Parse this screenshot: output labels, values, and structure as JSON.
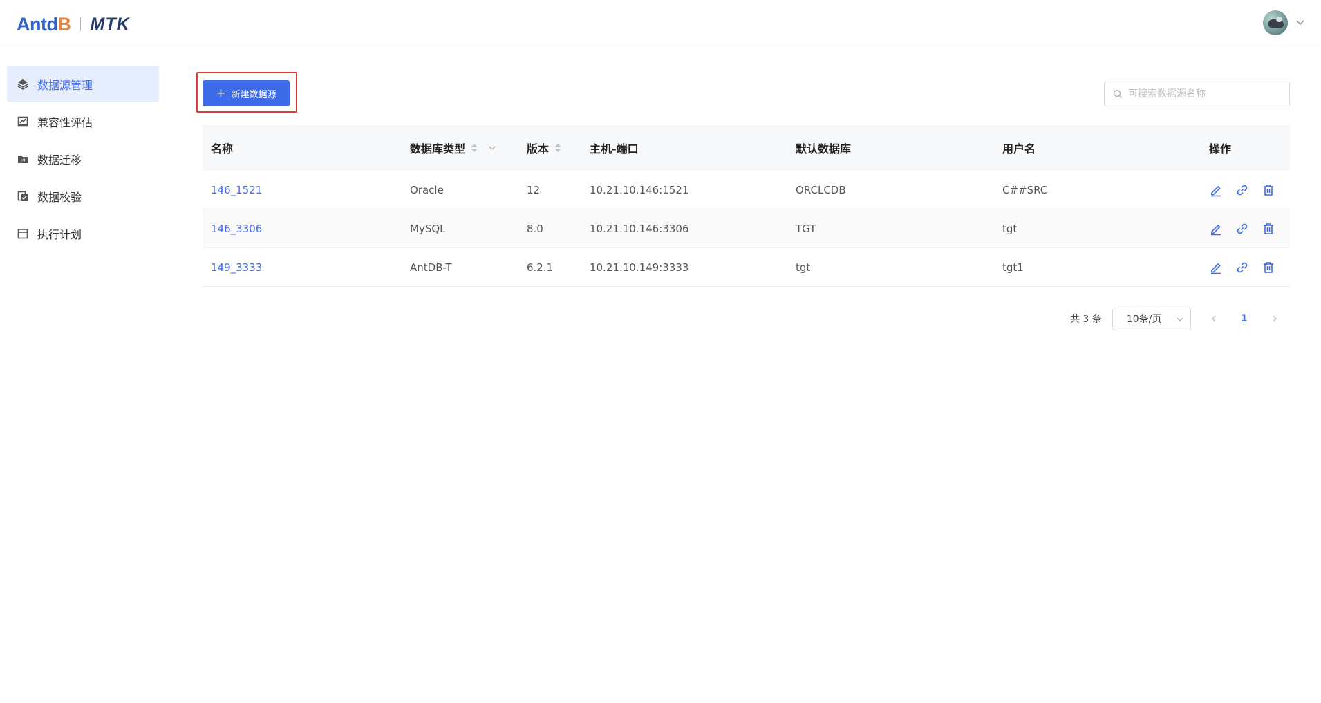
{
  "header": {
    "logo_part1": "Antd",
    "logo_part2": "B",
    "app_name": "MTK"
  },
  "sidebar": {
    "items": [
      {
        "label": "数据源管理",
        "icon": "layers-icon",
        "active": true
      },
      {
        "label": "兼容性评估",
        "icon": "chart-board-icon",
        "active": false
      },
      {
        "label": "数据迁移",
        "icon": "folder-arrow-icon",
        "active": false
      },
      {
        "label": "数据校验",
        "icon": "document-check-icon",
        "active": false
      },
      {
        "label": "执行计划",
        "icon": "calendar-icon",
        "active": false
      }
    ]
  },
  "toolbar": {
    "new_button_label": "新建数据源",
    "search_placeholder": "可搜索数据源名称"
  },
  "table": {
    "headers": {
      "name": "名称",
      "type": "数据库类型",
      "version": "版本",
      "host": "主机-端口",
      "default_db": "默认数据库",
      "user": "用户名",
      "ops": "操作"
    },
    "rows": [
      {
        "name": "146_1521",
        "type": "Oracle",
        "version": "12",
        "host": "10.21.10.146:1521",
        "default_db": "ORCLCDB",
        "user": "C##SRC"
      },
      {
        "name": "146_3306",
        "type": "MySQL",
        "version": "8.0",
        "host": "10.21.10.146:3306",
        "default_db": "TGT",
        "user": "tgt"
      },
      {
        "name": "149_3333",
        "type": "AntDB-T",
        "version": "6.2.1",
        "host": "10.21.10.149:3333",
        "default_db": "tgt",
        "user": "tgt1"
      }
    ]
  },
  "pagination": {
    "total": "共 3 条",
    "page_size": "10条/页",
    "current_page": "1"
  },
  "colors": {
    "primary": "#3e6be8",
    "highlight_border": "#e53935",
    "active_nav_bg": "#e6edfc"
  }
}
